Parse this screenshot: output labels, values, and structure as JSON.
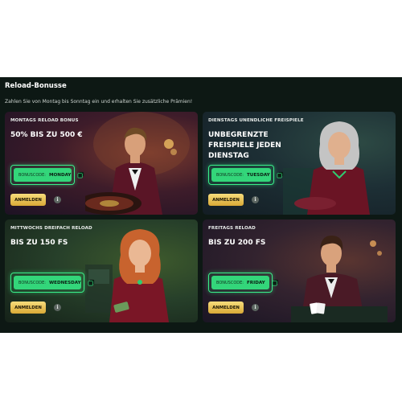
{
  "section": {
    "title": "Reload-Bonusse",
    "subtitle": "Zahlen Sie von Montag bis Sonntag ein und erhalten Sie zusätzliche Prämien!"
  },
  "common": {
    "code_prefix": "BONUSCODE:",
    "claim_label": "ANMELDEN",
    "info_glyph": "i"
  },
  "cards": [
    {
      "label": "MONTAGS RELOAD BONUS",
      "headline": "50% BIS ZU 500 €",
      "code": "MONDAY",
      "scene": "roulette-dealer-man"
    },
    {
      "label": "DIENSTAGS UNENDLICHE FREISPIELE",
      "headline": "UNBEGRENZTE FREISPIELE JEDEN DIENSTAG",
      "code": "TUESDAY",
      "scene": "grey-haired-woman"
    },
    {
      "label": "MITTWOCHS DREIFACH RELOAD",
      "headline": "BIS ZU 150 FS",
      "code": "WEDNESDAY",
      "scene": "red-haired-woman"
    },
    {
      "label": "FREITAGS RELOAD",
      "headline": "BIS ZU 200 FS",
      "code": "FRIDAY",
      "scene": "man-with-cards"
    }
  ],
  "colors": {
    "panel_bg": "#0d1814",
    "code_green": "#33d67a",
    "code_border": "#39f08a",
    "button_gold": "#e8c150"
  },
  "icons": [
    "copy-icon",
    "info-icon"
  ]
}
